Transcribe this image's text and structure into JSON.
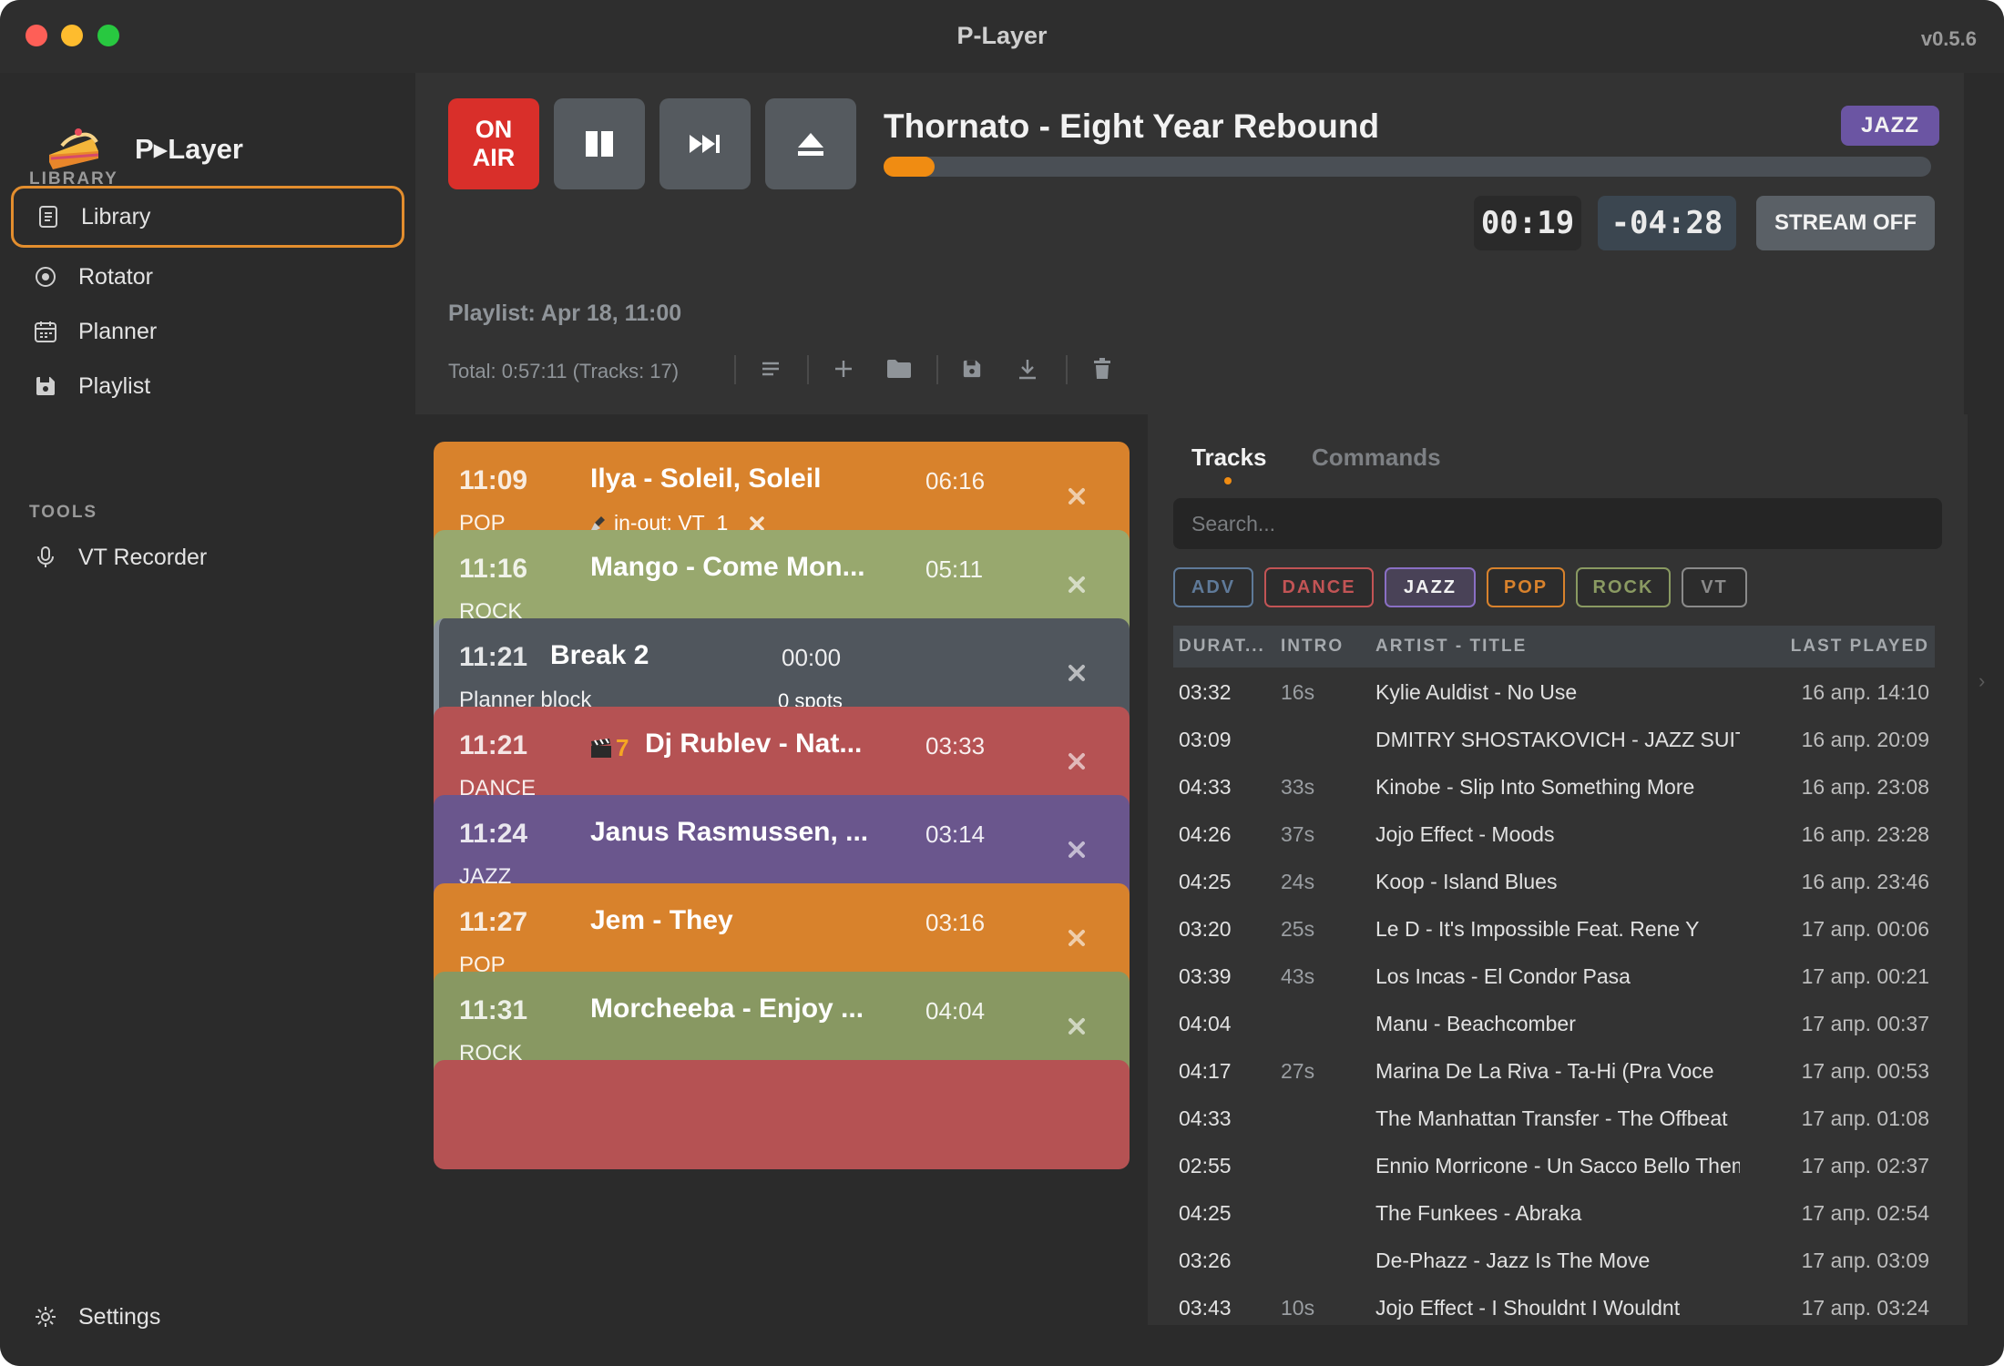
{
  "window": {
    "title": "P-Layer",
    "version": "v0.5.6"
  },
  "sidebar": {
    "app_name": "P▸Layer",
    "library_label": "LIBRARY",
    "tools_label": "TOOLS",
    "items": [
      {
        "label": "Library",
        "icon": "document-icon",
        "active": true
      },
      {
        "label": "Rotator",
        "icon": "target-icon"
      },
      {
        "label": "Planner",
        "icon": "calendar-icon"
      },
      {
        "label": "Playlist",
        "icon": "floppy-icon"
      }
    ],
    "tools": [
      {
        "label": "VT Recorder",
        "icon": "microphone-icon"
      }
    ],
    "settings_label": "Settings"
  },
  "transport": {
    "on_air_line1": "ON",
    "on_air_line2": "AIR",
    "now_playing": "Thornato - Eight Year Rebound",
    "genre": "JAZZ",
    "progress": 0.047,
    "elapsed": "00:19",
    "remaining": "-04:28",
    "stream_label": "STREAM OFF",
    "colors": {
      "on_air": "#d92f2a",
      "progress": "#f08c12",
      "jazz": "#6b55a3"
    }
  },
  "playlist": {
    "name": "Playlist: Apr 18, 11:00",
    "total": "Total: 0:57:11 (Tracks: 17)",
    "items": [
      {
        "time": "11:09",
        "genre": "POP",
        "title": "Ilya - Soleil, Soleil",
        "duration": "06:16",
        "sub": "in-out: VT_1"
      },
      {
        "time": "11:16",
        "genre": "ROCK",
        "title": "Mango - Come Mon...",
        "duration": "05:11"
      },
      {
        "time": "11:21",
        "genre": "Planner block",
        "title": "Break 2",
        "duration": "00:00",
        "spots": "0 spots"
      },
      {
        "time": "11:21",
        "genre": "DANCE",
        "title": "Dj Rublev - Nat...",
        "duration": "03:33",
        "badge_num": "7"
      },
      {
        "time": "11:24",
        "genre": "JAZZ",
        "title": "Janus Rasmussen, ...",
        "duration": "03:14"
      },
      {
        "time": "11:27",
        "genre": "POP",
        "title": "Jem - They",
        "duration": "03:16"
      },
      {
        "time": "11:31",
        "genre": "ROCK",
        "title": "Morcheeba - Enjoy ...",
        "duration": "04:04"
      }
    ]
  },
  "library": {
    "tabs": [
      "Tracks",
      "Commands"
    ],
    "search_placeholder": "Search...",
    "chips": [
      {
        "label": "ADV",
        "color": "#5f7a99"
      },
      {
        "label": "DANCE",
        "color": "#c25455"
      },
      {
        "label": "JAZZ",
        "color": "#8a6fc4"
      },
      {
        "label": "POP",
        "color": "#d8822c"
      },
      {
        "label": "ROCK",
        "color": "#8a9a62"
      },
      {
        "label": "VT",
        "color": "#8a8a8a"
      }
    ],
    "columns": [
      "DURAT...",
      "INTRO",
      "ARTIST - TITLE",
      "LAST PLAYED"
    ],
    "rows": [
      {
        "dur": "03:32",
        "intro": "16s",
        "title": "Kylie Auldist - No Use",
        "last": "16 апр. 14:10"
      },
      {
        "dur": "03:09",
        "intro": "",
        "title": "DMITRY SHOSTAKOVICH - JAZZ SUITE",
        "last": "16 апр. 20:09"
      },
      {
        "dur": "04:33",
        "intro": "33s",
        "title": "Kinobe - Slip Into Something More",
        "last": "16 апр. 23:08"
      },
      {
        "dur": "04:26",
        "intro": "37s",
        "title": "Jojo Effect - Moods",
        "last": "16 апр. 23:28"
      },
      {
        "dur": "04:25",
        "intro": "24s",
        "title": "Koop - Island Blues",
        "last": "16 апр. 23:46"
      },
      {
        "dur": "03:20",
        "intro": "25s",
        "title": "Le D - It's Impossible Feat. Rene Y",
        "last": "17 апр. 00:06"
      },
      {
        "dur": "03:39",
        "intro": "43s",
        "title": "Los Incas - El Condor Pasa",
        "last": "17 апр. 00:21"
      },
      {
        "dur": "04:04",
        "intro": "",
        "title": "Manu - Beachcomber",
        "last": "17 апр. 00:37"
      },
      {
        "dur": "04:17",
        "intro": "27s",
        "title": "Marina De La Riva - Ta-Hi (Pra Voce",
        "last": "17 апр. 00:53"
      },
      {
        "dur": "04:33",
        "intro": "",
        "title": "The Manhattan Transfer - The Offbeat",
        "last": "17 апр. 01:08"
      },
      {
        "dur": "02:55",
        "intro": "",
        "title": "Ennio Morricone - Un Sacco Bello Theme",
        "last": "17 апр. 02:37"
      },
      {
        "dur": "04:25",
        "intro": "",
        "title": "The Funkees - Abraka",
        "last": "17 апр. 02:54"
      },
      {
        "dur": "03:26",
        "intro": "",
        "title": "De-Phazz - Jazz Is The Move",
        "last": "17 апр. 03:09"
      },
      {
        "dur": "03:43",
        "intro": "10s",
        "title": "Jojo Effect - I Shouldnt I Wouldnt",
        "last": "17 апр. 03:24"
      }
    ]
  }
}
